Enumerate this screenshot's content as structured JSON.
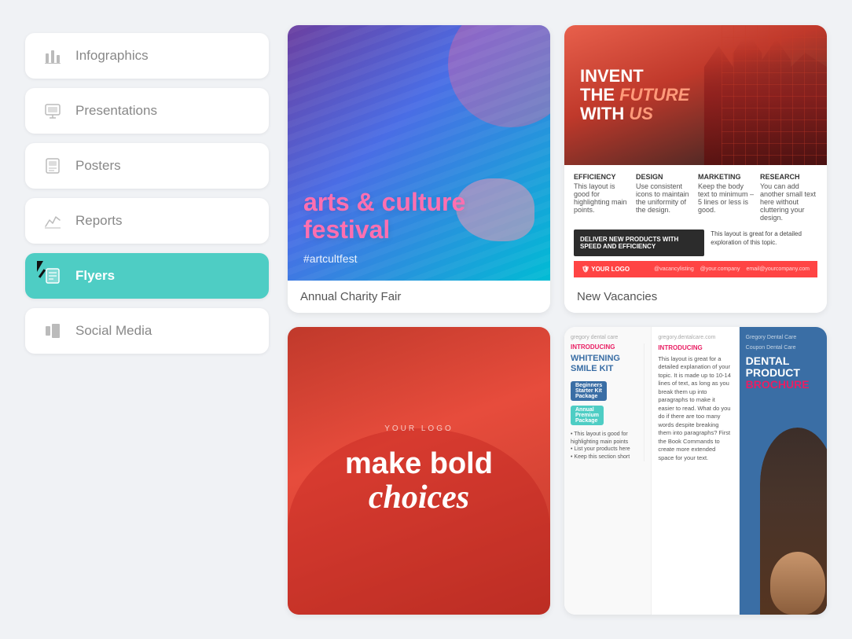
{
  "sidebar": {
    "items": [
      {
        "id": "infographics",
        "label": "Infographics",
        "icon": "📊",
        "active": false
      },
      {
        "id": "presentations",
        "label": "Presentations",
        "icon": "🖼",
        "active": false
      },
      {
        "id": "posters",
        "label": "Posters",
        "icon": "🖼",
        "active": false
      },
      {
        "id": "reports",
        "label": "Reports",
        "icon": "📈",
        "active": false
      },
      {
        "id": "flyers",
        "label": "Flyers",
        "icon": "📋",
        "active": true
      },
      {
        "id": "social-media",
        "label": "Social Media",
        "icon": "📊",
        "active": false
      }
    ]
  },
  "cards": [
    {
      "id": "arts-festival",
      "type": "arts",
      "title": "arts & culture festival",
      "hashtag": "#artcultfest",
      "label": "Annual Charity Fair"
    },
    {
      "id": "new-vacancies",
      "type": "vacancies",
      "headline_line1": "INVENT",
      "headline_line2": "THE FUTURE",
      "headline_line3": "WITH US",
      "features": [
        "EFFICIENCY",
        "DESIGN",
        "MARKETING",
        "RESEARCH"
      ],
      "dark_box_text": "DELIVER NEW PRODUCTS WITH SPEED AND EFFICIENCY",
      "body_text": "This layout is great for a detailed exploration of this topic.",
      "label": "New Vacancies"
    },
    {
      "id": "bold-choices",
      "type": "bold",
      "logo": "YOUR LOGO",
      "line1": "make bold",
      "line2": "choices",
      "label": ""
    },
    {
      "id": "dental",
      "type": "dental",
      "left_title": "INTRODUCING WHITENING SMILE KIT",
      "left_tag1": "Beginners Starter Kit Package",
      "left_tag2": "Annual Premium Package",
      "mid_title": "GREGORY DENTAL CARE",
      "mid_intro": "INTRODUCING",
      "right_title": "DENTAL PRODUCT",
      "right_subtitle": "BROCHURE",
      "label": ""
    }
  ]
}
